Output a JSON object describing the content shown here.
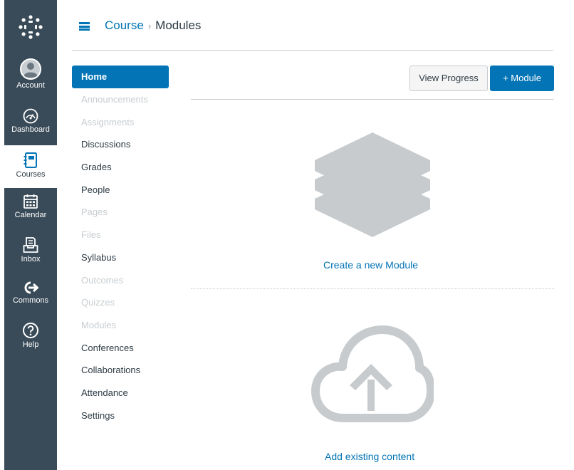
{
  "global_nav": {
    "items": [
      {
        "label": "Account",
        "icon": "user-avatar-icon"
      },
      {
        "label": "Dashboard",
        "icon": "dashboard-icon"
      },
      {
        "label": "Courses",
        "icon": "courses-icon"
      },
      {
        "label": "Calendar",
        "icon": "calendar-icon"
      },
      {
        "label": "Inbox",
        "icon": "inbox-icon"
      },
      {
        "label": "Commons",
        "icon": "commons-icon"
      },
      {
        "label": "Help",
        "icon": "help-icon"
      }
    ],
    "active": "Courses"
  },
  "header": {
    "breadcrumb_course": "Course",
    "breadcrumb_separator": "›",
    "breadcrumb_current": "Modules"
  },
  "course_nav": {
    "items": [
      {
        "label": "Home",
        "state": "active"
      },
      {
        "label": "Announcements",
        "state": "disabled"
      },
      {
        "label": "Assignments",
        "state": "disabled"
      },
      {
        "label": "Discussions",
        "state": "enabled"
      },
      {
        "label": "Grades",
        "state": "enabled"
      },
      {
        "label": "People",
        "state": "enabled"
      },
      {
        "label": "Pages",
        "state": "disabled"
      },
      {
        "label": "Files",
        "state": "disabled"
      },
      {
        "label": "Syllabus",
        "state": "enabled"
      },
      {
        "label": "Outcomes",
        "state": "disabled"
      },
      {
        "label": "Quizzes",
        "state": "disabled"
      },
      {
        "label": "Modules",
        "state": "disabled"
      },
      {
        "label": "Conferences",
        "state": "enabled"
      },
      {
        "label": "Collaborations",
        "state": "enabled"
      },
      {
        "label": "Attendance",
        "state": "enabled"
      },
      {
        "label": "Settings",
        "state": "enabled"
      }
    ]
  },
  "toolbar": {
    "view_progress_label": "View Progress",
    "add_module_label": "+ Module"
  },
  "empty_state": {
    "create_module_link": "Create a new Module",
    "add_content_link": "Add existing content"
  },
  "colors": {
    "nav_bg": "#394b58",
    "brand_blue": "#0374b5",
    "illustration_gray": "#c7cbcd"
  }
}
